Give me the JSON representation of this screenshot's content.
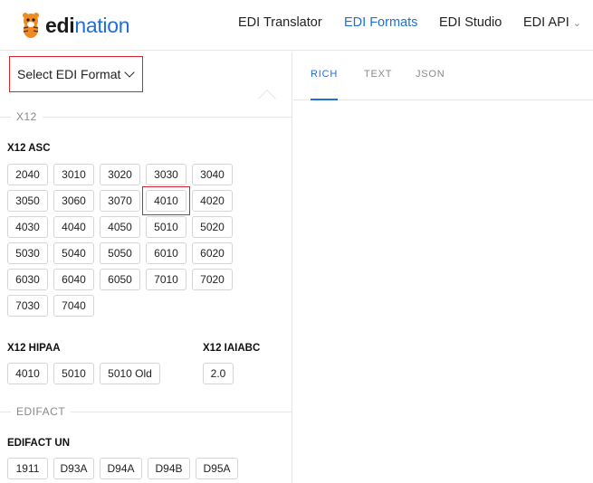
{
  "brand": {
    "edi": "edi",
    "nation": "nation",
    "colors": {
      "blue": "#1f6fd6",
      "red": "#d9232e",
      "orange": "#f08a24"
    }
  },
  "nav": {
    "items": [
      "EDI Translator",
      "EDI Formats",
      "EDI Studio",
      "EDI API"
    ],
    "active": "EDI Formats"
  },
  "format_selector": {
    "label": "Select EDI Format"
  },
  "sections": {
    "x12": {
      "label": "X12",
      "asc": {
        "title": "X12 ASC",
        "versions": [
          "2040",
          "3010",
          "3020",
          "3030",
          "3040",
          "3050",
          "3060",
          "3070",
          "4010",
          "4020",
          "4030",
          "4040",
          "4050",
          "5010",
          "5020",
          "5030",
          "5040",
          "5050",
          "6010",
          "6020",
          "6030",
          "6040",
          "6050",
          "7010",
          "7020",
          "7030",
          "7040"
        ],
        "selected": "4010"
      },
      "hipaa": {
        "title": "X12 HIPAA",
        "versions": [
          "4010",
          "5010",
          "5010 Old"
        ]
      },
      "iaiabc": {
        "title": "X12 IAIABC",
        "versions": [
          "2.0"
        ]
      }
    },
    "edifact": {
      "label": "EDIFACT",
      "un": {
        "title": "EDIFACT UN",
        "versions": [
          "1911",
          "D93A",
          "D94A",
          "D94B",
          "D95A"
        ]
      }
    }
  },
  "tabs": {
    "items": [
      "RICH",
      "TEXT",
      "JSON"
    ],
    "active": "RICH"
  }
}
